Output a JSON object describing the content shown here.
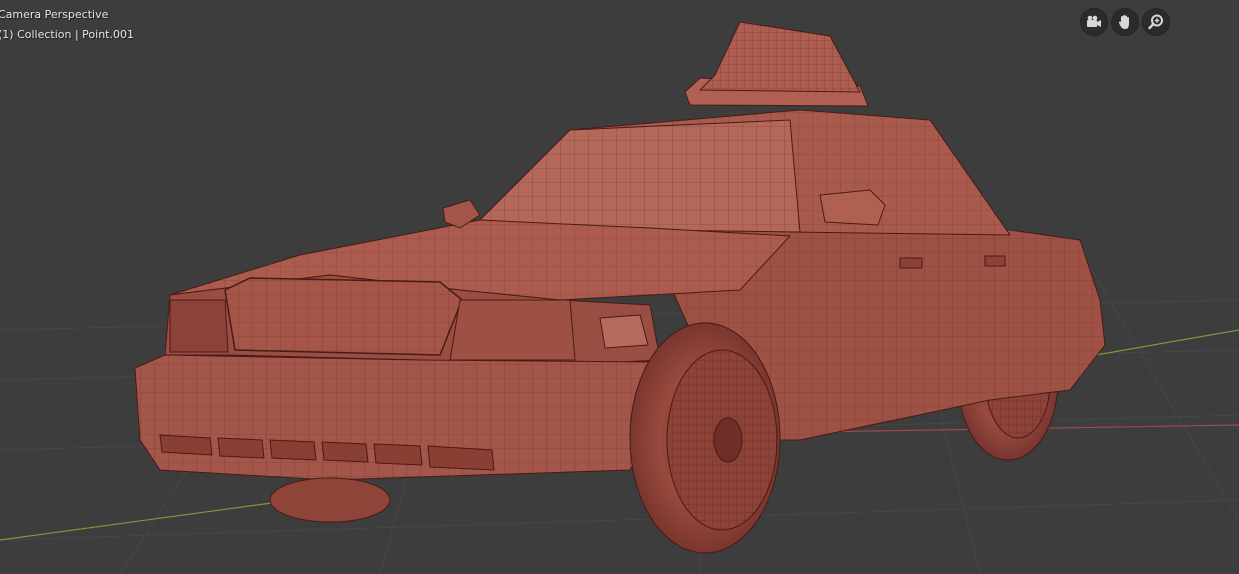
{
  "viewport": {
    "view_label": "Camera Perspective",
    "collection_label": "(1) Collection | Point.001"
  },
  "nav_gizmos": [
    {
      "name": "camera-view-icon"
    },
    {
      "name": "pan-hand-icon"
    },
    {
      "name": "zoom-magnifier-icon"
    }
  ],
  "colors": {
    "background": "#3d3d3d",
    "grid": "#454545",
    "axis_x": "#a04848",
    "axis_y": "#7a9a3a",
    "mesh_fill": "#a3564a",
    "mesh_light": "#b8685a",
    "mesh_dark": "#7c3a32",
    "wire": "#4a1a16"
  }
}
